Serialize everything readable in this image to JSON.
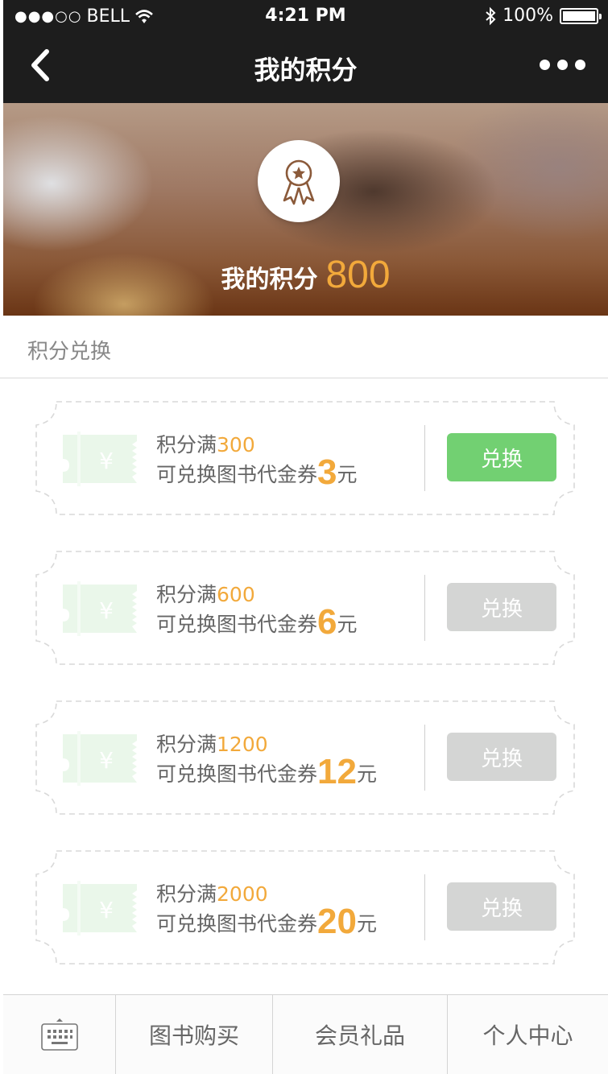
{
  "status_bar": {
    "signal_dots": "●●●○○",
    "carrier": "BELL",
    "time": "4:21 PM",
    "battery": "100%"
  },
  "header": {
    "title": "我的积分",
    "back_icon": "chevron-left-icon",
    "more_icon": "more-dots-icon"
  },
  "banner": {
    "badge_icon": "award-ribbon-icon",
    "label": "我的积分",
    "points": "800",
    "points_color": "#f2a93b"
  },
  "section": {
    "title": "积分兑换"
  },
  "coupons": [
    {
      "line1_prefix": "积分满",
      "points": "300",
      "line2_prefix": "可兑换图书代金券",
      "amount": "3",
      "unit": "元",
      "button": "兑换",
      "enabled": true
    },
    {
      "line1_prefix": "积分满",
      "points": "600",
      "line2_prefix": "可兑换图书代金券",
      "amount": "6",
      "unit": "元",
      "button": "兑换",
      "enabled": false
    },
    {
      "line1_prefix": "积分满",
      "points": "1200",
      "line2_prefix": "可兑换图书代金券",
      "amount": "12",
      "unit": "元",
      "button": "兑换",
      "enabled": false
    },
    {
      "line1_prefix": "积分满",
      "points": "2000",
      "line2_prefix": "可兑换图书代金券",
      "amount": "20",
      "unit": "元",
      "button": "兑换",
      "enabled": false
    }
  ],
  "colors": {
    "active_button": "#72d072",
    "disabled_button": "#d4d5d4",
    "accent": "#f2a93b",
    "header_bg": "#1d1d1d"
  },
  "tabbar": {
    "keyboard_icon": "keyboard-icon",
    "items": [
      "图书购买",
      "会员礼品",
      "个人中心"
    ]
  }
}
